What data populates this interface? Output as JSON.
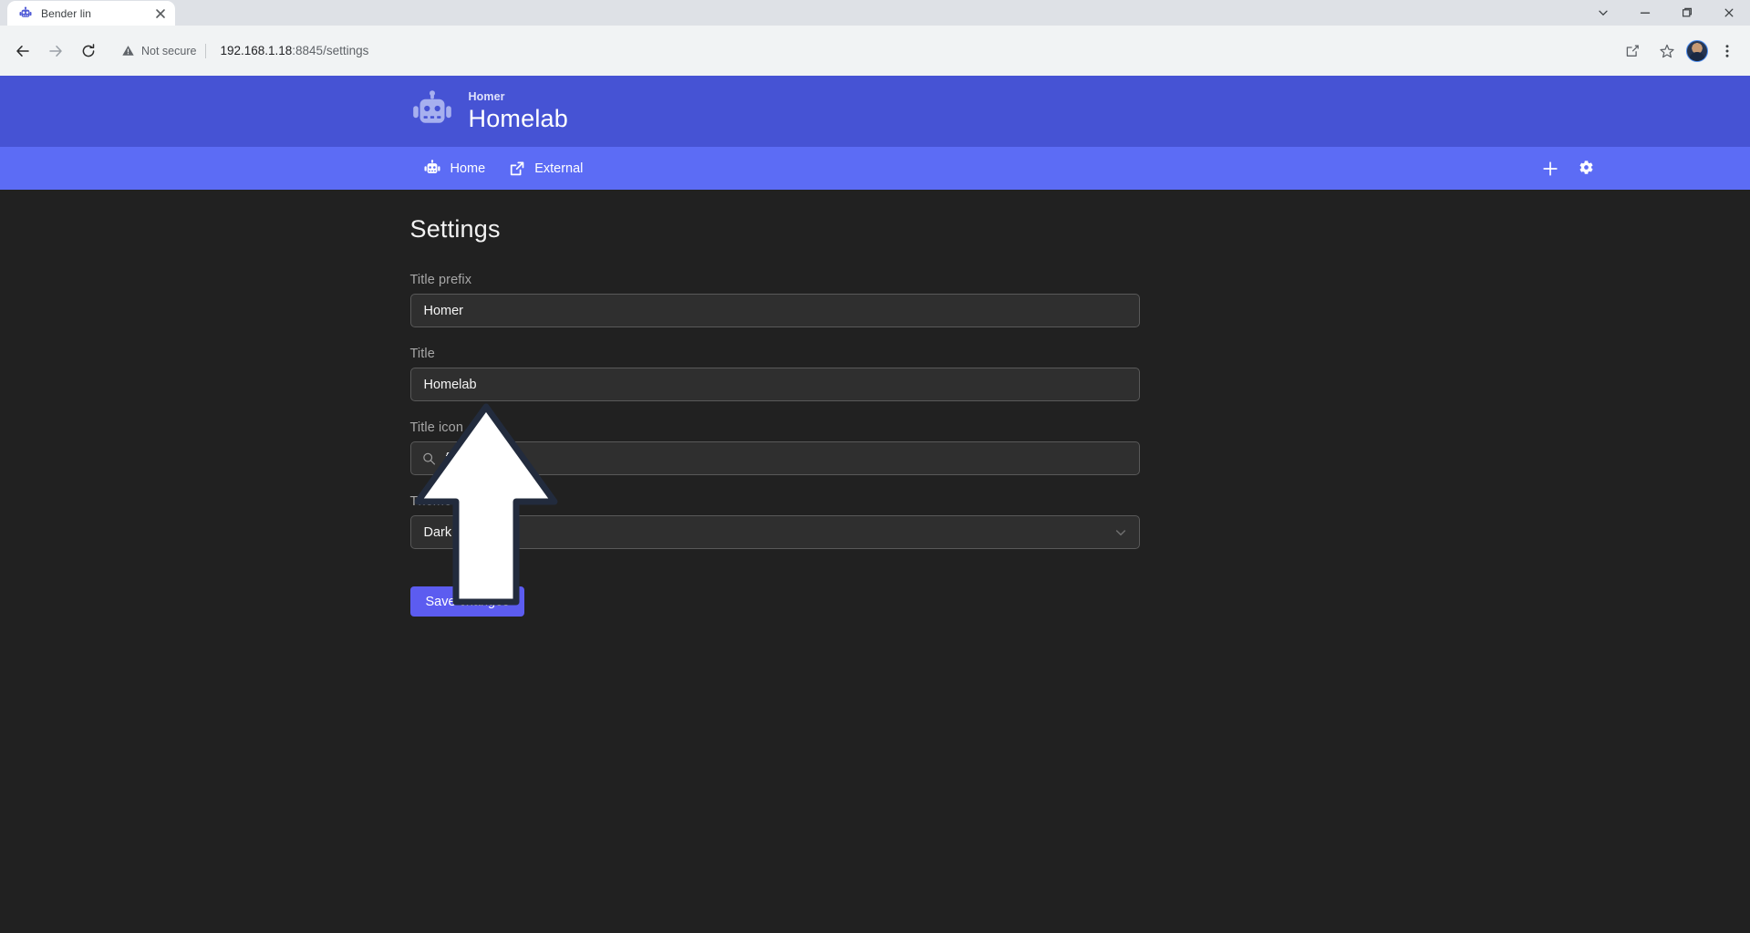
{
  "browser": {
    "tab": {
      "title": "Bender lin",
      "favicon_icon": "robot-favicon",
      "close_icon": "close-icon"
    },
    "window_controls": {
      "chevron_icon": "chevron-down-icon",
      "minimize_icon": "minimize-icon",
      "maximize_icon": "maximize-icon",
      "close_icon": "close-icon"
    },
    "toolbar": {
      "back_icon": "back-arrow-icon",
      "forward_icon": "forward-arrow-icon",
      "reload_icon": "reload-icon",
      "security_label": "Not secure",
      "security_icon": "warning-triangle-icon",
      "url_host": "192.168.1.18",
      "url_rest": ":8845/settings",
      "share_icon": "share-icon",
      "bookmark_icon": "star-icon",
      "profile_icon": "avatar",
      "menu_icon": "three-dot-menu-icon"
    }
  },
  "header": {
    "logo_icon": "robot-icon",
    "subtitle": "Homer",
    "title": "Homelab",
    "bg_color": "#4653d4"
  },
  "nav": {
    "bg_color": "#5c6cf5",
    "links": [
      {
        "label": "Home",
        "icon": "robot-icon"
      },
      {
        "label": "External",
        "icon": "external-link-icon"
      }
    ],
    "actions": [
      {
        "name": "add-button",
        "icon": "plus-icon"
      },
      {
        "name": "settings-button",
        "icon": "gear-icon"
      }
    ]
  },
  "settings": {
    "page_title": "Settings",
    "fields": {
      "title_prefix": {
        "label": "Title prefix",
        "value": "Homer"
      },
      "title": {
        "label": "Title",
        "value": "Homelab"
      },
      "title_icon": {
        "label": "Title icon",
        "value": "fas fa-robot",
        "icon": "search-icon"
      },
      "theme": {
        "label": "Theme",
        "value": "Dark",
        "icon": "chevron-down-icon"
      }
    },
    "save_label": "Save changes",
    "accent_color": "#5c5cf0",
    "background_color": "#212121"
  },
  "annotation": {
    "arrow_icon": "up-arrow-annotation",
    "fill": "#ffffff",
    "stroke": "#222b3d"
  }
}
